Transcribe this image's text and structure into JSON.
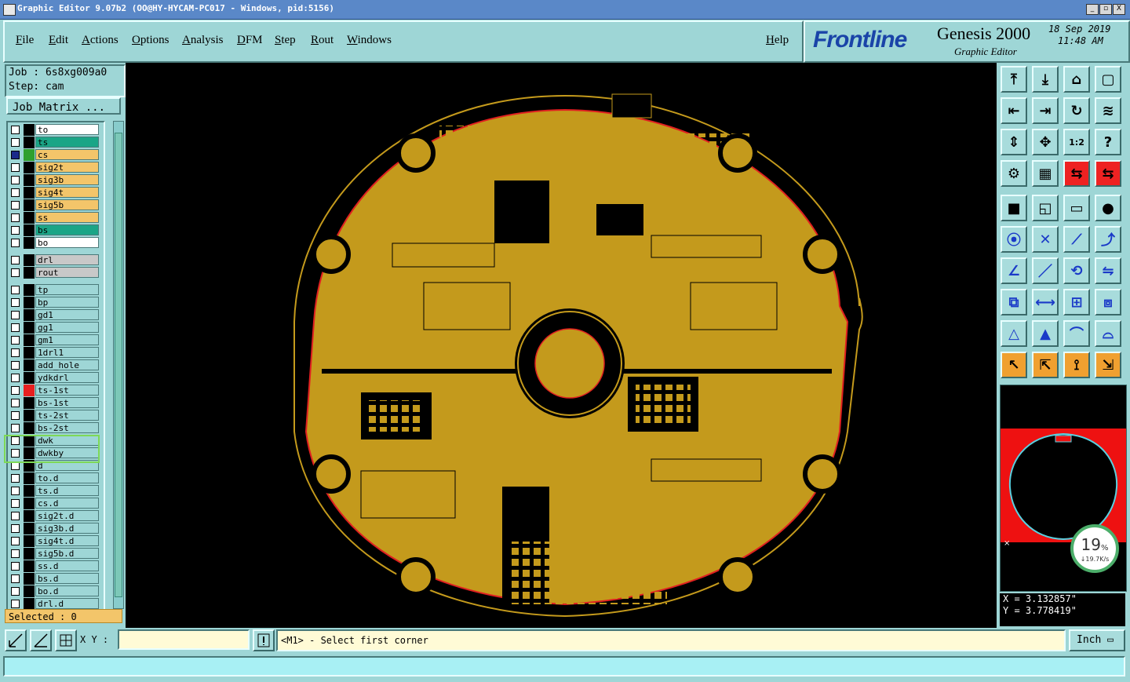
{
  "window": {
    "title": "Graphic Editor 9.07b2 (OO@HY-HYCAM-PC017 - Windows, pid:5156)",
    "buttons": [
      "_",
      "▫",
      "X"
    ]
  },
  "menu": {
    "items": [
      "File",
      "Edit",
      "Actions",
      "Options",
      "Analysis",
      "DFM",
      "Step",
      "Rout",
      "Windows"
    ],
    "help": "Help"
  },
  "brand": {
    "logo": "Frontline",
    "product": "Genesis 2000",
    "subtitle": "Graphic Editor",
    "date": "18 Sep 2019",
    "time": "11:48 AM"
  },
  "job": {
    "job_line": "Job : 6s8xg009a0",
    "step_line": "Step: cam",
    "matrix_button": "Job Matrix ..."
  },
  "layers": [
    {
      "name": "to",
      "color": "#ffffff",
      "swatch": "#000000"
    },
    {
      "name": "ts",
      "color": "#1aa586",
      "swatch": "#000000"
    },
    {
      "name": "cs",
      "color": "#f3c56a",
      "swatch": "#2fa02f",
      "active": true
    },
    {
      "name": "sig2t",
      "color": "#f3c56a",
      "swatch": "#000000"
    },
    {
      "name": "sig3b",
      "color": "#f3c56a",
      "swatch": "#000000"
    },
    {
      "name": "sig4t",
      "color": "#f3c56a",
      "swatch": "#000000"
    },
    {
      "name": "sig5b",
      "color": "#f3c56a",
      "swatch": "#000000"
    },
    {
      "name": "ss",
      "color": "#f3c56a",
      "swatch": "#000000"
    },
    {
      "name": "bs",
      "color": "#1aa586",
      "swatch": "#000000"
    },
    {
      "name": "bo",
      "color": "#ffffff",
      "swatch": "#000000"
    },
    {
      "name": "drl",
      "color": "#c8c8c8",
      "swatch": "#000000",
      "gap": true
    },
    {
      "name": "rout",
      "color": "#c8c8c8",
      "swatch": "#000000"
    },
    {
      "name": "tp",
      "color": "#9ed6d6",
      "swatch": "#000000",
      "gap": true
    },
    {
      "name": "bp",
      "color": "#9ed6d6",
      "swatch": "#000000"
    },
    {
      "name": "gd1",
      "color": "#9ed6d6",
      "swatch": "#000000"
    },
    {
      "name": "gg1",
      "color": "#9ed6d6",
      "swatch": "#000000"
    },
    {
      "name": "gm1",
      "color": "#9ed6d6",
      "swatch": "#000000"
    },
    {
      "name": "1drl1",
      "color": "#9ed6d6",
      "swatch": "#000000"
    },
    {
      "name": "add_hole",
      "color": "#9ed6d6",
      "swatch": "#000000"
    },
    {
      "name": "ydkdrl",
      "color": "#9ed6d6",
      "swatch": "#000000"
    },
    {
      "name": "ts-1st",
      "color": "#9ed6d6",
      "swatch": "#e82020"
    },
    {
      "name": "bs-1st",
      "color": "#9ed6d6",
      "swatch": "#000000"
    },
    {
      "name": "ts-2st",
      "color": "#9ed6d6",
      "swatch": "#000000"
    },
    {
      "name": "bs-2st",
      "color": "#9ed6d6",
      "swatch": "#000000"
    },
    {
      "name": "dwk",
      "color": "#9ed6d6",
      "swatch": "#000000"
    },
    {
      "name": "dwkby",
      "color": "#9ed6d6",
      "swatch": "#000000"
    },
    {
      "name": "d",
      "color": "#9ed6d6",
      "swatch": "#000000"
    },
    {
      "name": "to.d",
      "color": "#9ed6d6",
      "swatch": "#000000"
    },
    {
      "name": "ts.d",
      "color": "#9ed6d6",
      "swatch": "#000000"
    },
    {
      "name": "cs.d",
      "color": "#9ed6d6",
      "swatch": "#000000"
    },
    {
      "name": "sig2t.d",
      "color": "#9ed6d6",
      "swatch": "#000000"
    },
    {
      "name": "sig3b.d",
      "color": "#9ed6d6",
      "swatch": "#000000"
    },
    {
      "name": "sig4t.d",
      "color": "#9ed6d6",
      "swatch": "#000000"
    },
    {
      "name": "sig5b.d",
      "color": "#9ed6d6",
      "swatch": "#000000"
    },
    {
      "name": "ss.d",
      "color": "#9ed6d6",
      "swatch": "#000000"
    },
    {
      "name": "bs.d",
      "color": "#9ed6d6",
      "swatch": "#000000"
    },
    {
      "name": "bo.d",
      "color": "#9ed6d6",
      "swatch": "#000000"
    },
    {
      "name": "drl.d",
      "color": "#9ed6d6",
      "swatch": "#000000"
    }
  ],
  "selected": "Selected : 0",
  "status": {
    "xy_label": "X Y :",
    "xy_value": "",
    "prompt": "<M1> - Select first corner",
    "units": "Inch"
  },
  "coords": {
    "x": "X = 3.132857\"",
    "y": "Y = 3.778419\""
  },
  "netmeter": {
    "percent": "19",
    "percent_sign": "%",
    "speed": "↓19.7K/s"
  },
  "colors": {
    "copper": "#c49a1c",
    "board_bg": "#000000",
    "outline_red": "#e02020",
    "panel_bg": "#9ed6d6"
  },
  "toolbar_icons": [
    "fit-screen-icon",
    "zoom-home-icon",
    "step-home-icon",
    "window-icon",
    "pan-left-icon",
    "pan-right-icon",
    "redraw-icon",
    "snap-icon",
    "zoom-fit-icon",
    "zoom-area-icon",
    "zoom-1to2-icon",
    "help-icon",
    "measure-icon",
    "grid-icon",
    "layer-compare-icon",
    "layer-compare2-icon",
    "fill-icon",
    "outline-icon",
    "ruler-icon",
    "pad-icon",
    "net-icon",
    "delete-icon",
    "connect-icon",
    "route-icon",
    "angle-icon",
    "line-icon",
    "arc-icon",
    "flip-icon",
    "copy-icon",
    "move-icon",
    "resize-icon",
    "group-icon",
    "triangle-icon",
    "triangle-up-icon",
    "arc-up-icon",
    "arc-line-icon",
    "select-icon",
    "select-box-icon",
    "select-lasso-icon",
    "select-net-icon"
  ]
}
